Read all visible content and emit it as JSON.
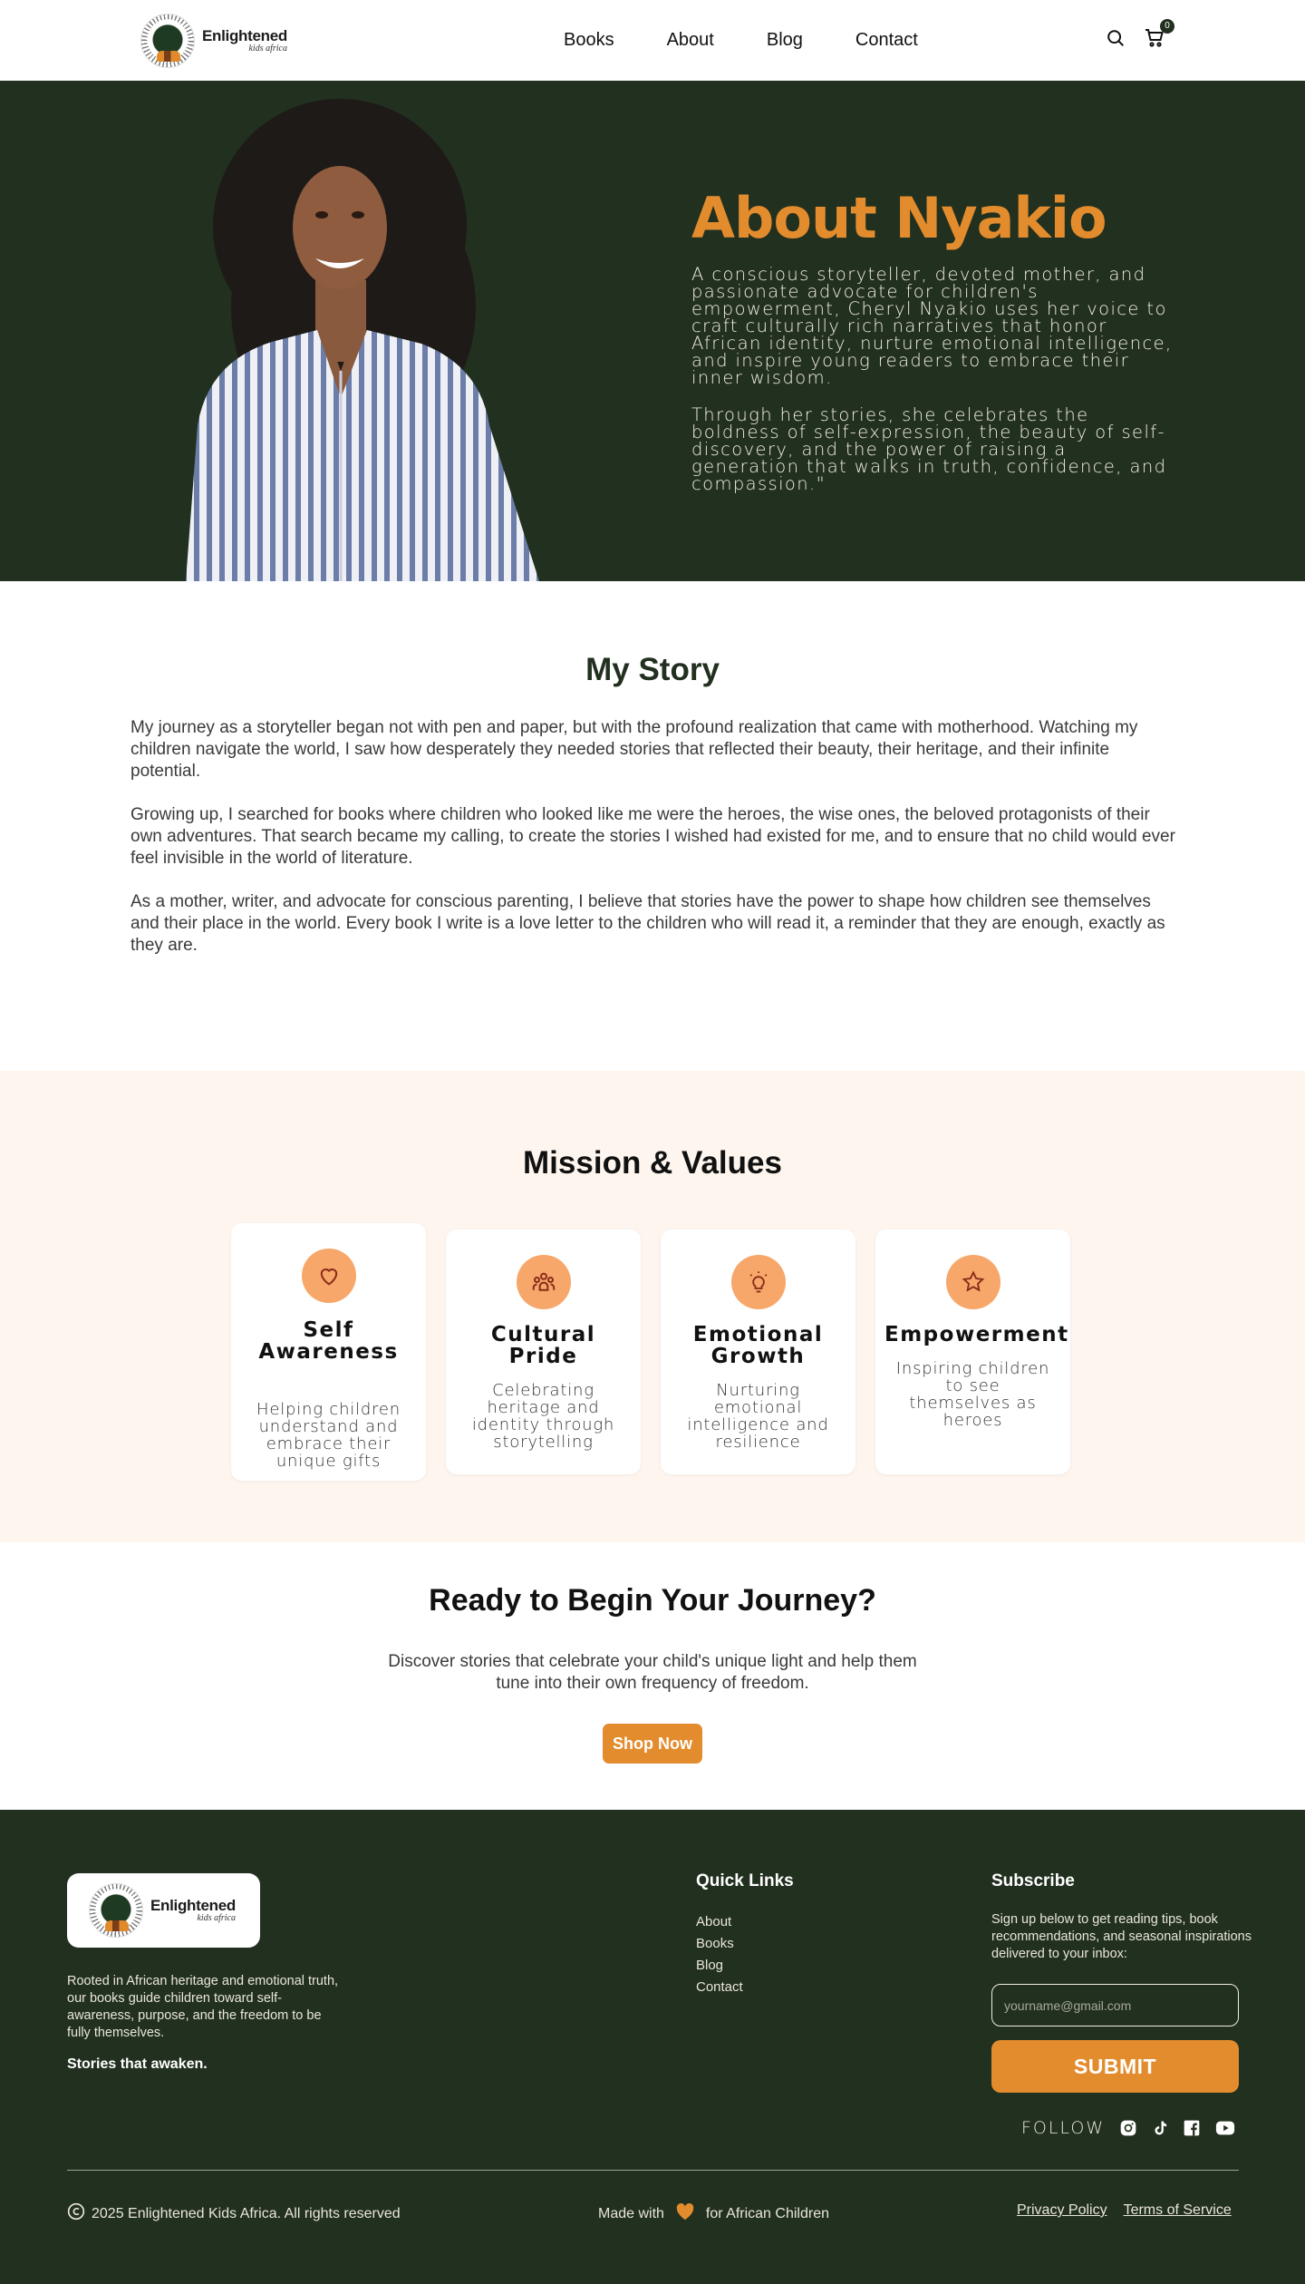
{
  "brand": {
    "name": "Enlightened",
    "sub": "kids africa"
  },
  "nav": [
    "Books",
    "About",
    "Blog",
    "Contact"
  ],
  "header": {
    "cart_count": "0"
  },
  "hero": {
    "title": "About Nyakio",
    "p1": "A conscious storyteller, devoted mother, and passionate advocate for children's empowerment, Cheryl Nyakio uses her voice to craft culturally rich narratives that honor African identity, nurture emotional intelligence, and inspire young readers to embrace their inner wisdom.",
    "p2": "Through her stories, she celebrates the boldness of self-expression, the beauty of self-discovery, and the power of raising a generation that walks in truth, confidence, and compassion.\""
  },
  "story": {
    "title": "My Story",
    "paragraphs": [
      "My journey as a storyteller began not with pen and paper, but with the profound realization that came with motherhood. Watching my children navigate the world, I saw how desperately they needed stories that reflected their beauty, their heritage, and their infinite potential.",
      "Growing up, I searched for books where children who looked like me were the heroes, the wise ones, the beloved protagonists of their own adventures. That search became my calling, to create the stories I wished had existed for me, and to ensure that no child would ever feel invisible in the world of literature.",
      "As a mother, writer, and advocate for conscious parenting, I believe that stories have the power to shape how children see themselves and their place in the world. Every book I write is a love letter to the children who will read it, a reminder that they are enough, exactly as they are."
    ]
  },
  "mission": {
    "title": "Mission & Values",
    "cards": [
      {
        "icon": "heart-icon",
        "title": "Self Awareness",
        "text": "Helping children understand and embrace their unique gifts"
      },
      {
        "icon": "people-icon",
        "title": "Cultural Pride",
        "text": "Celebrating heritage and identity through storytelling"
      },
      {
        "icon": "lightbulb-icon",
        "title": "Emotional Growth",
        "text": "Nurturing emotional intelligence and resilience"
      },
      {
        "icon": "star-icon",
        "title": "Empowerment",
        "text": "Inspiring children to see themselves as heroes"
      }
    ]
  },
  "cta": {
    "title": "Ready to Begin Your Journey?",
    "text": "Discover stories that celebrate your child's unique light and help them tune into their own frequency of freedom.",
    "button": "Shop Now"
  },
  "footer": {
    "about": "Rooted in African heritage and emotional truth, our books guide children toward self-awareness, purpose, and the freedom to be fully themselves.",
    "tagline": "Stories that awaken.",
    "quick_links_title": "Quick Links",
    "links": [
      "About",
      "Books",
      "Blog",
      "Contact"
    ],
    "subscribe_title": "Subscribe",
    "subscribe_text": "Sign up below to get reading tips, book recommendations, and seasonal inspirations delivered to your inbox:",
    "email_placeholder": "yourname@gmail.com",
    "submit": "SUBMIT",
    "follow": "FOLLOW",
    "social": [
      "instagram-icon",
      "tiktok-icon",
      "facebook-icon",
      "youtube-icon"
    ],
    "copyright": "2025 Enlightened Kids Africa. All rights reserved",
    "made_with_pre": "Made with",
    "made_with_post": "for African Children",
    "privacy": "Privacy Policy",
    "terms": "Terms of Service"
  },
  "colors": {
    "dark_green": "#22301f",
    "accent": "#e38c2e",
    "cream": "#fdf5ee",
    "icon_bg": "#f6a769"
  }
}
